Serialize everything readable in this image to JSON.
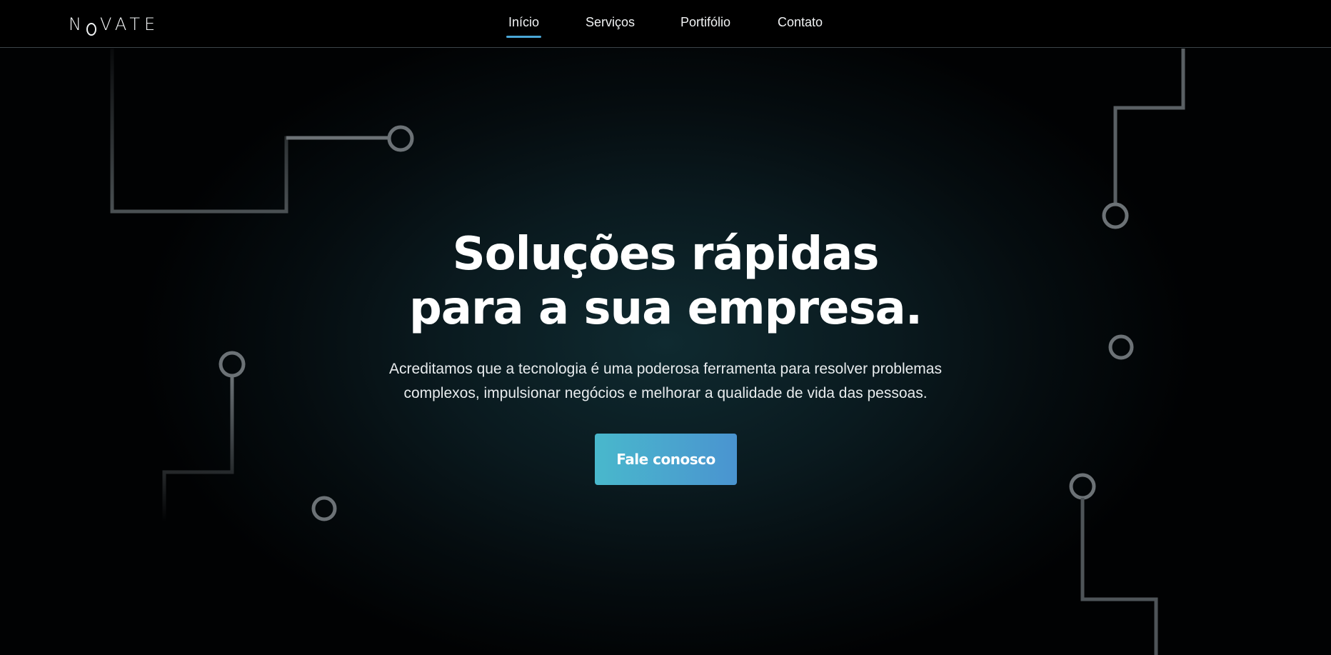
{
  "header": {
    "logo_left": "N",
    "logo_right": "VATE",
    "nav": [
      {
        "label": "Início",
        "active": true
      },
      {
        "label": "Serviços",
        "active": false
      },
      {
        "label": "Portifólio",
        "active": false
      },
      {
        "label": "Contato",
        "active": false
      }
    ]
  },
  "hero": {
    "title_line1": "Soluções rápidas",
    "title_line2": "para a sua empresa.",
    "subtitle_line1": "Acreditamos que a tecnologia é uma poderosa ferramenta para resolver problemas",
    "subtitle_line2": "complexos, impulsionar negócios e melhorar a qualidade de vida das pessoas.",
    "cta_label": "Fale conosco"
  },
  "colors": {
    "accent": "#4aa7d7",
    "cta_start": "#49b8cc",
    "cta_end": "#4a94d0",
    "circuit": "#6c7276"
  }
}
